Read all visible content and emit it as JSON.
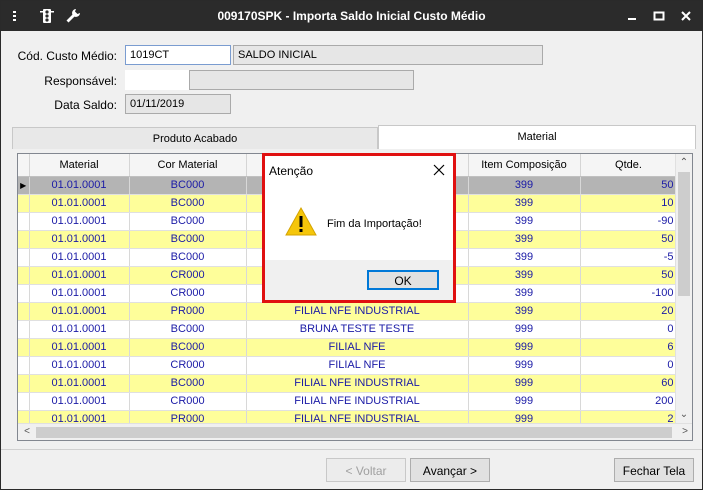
{
  "window": {
    "title": "009170SPK - Importa Saldo Inicial Custo Médio"
  },
  "form": {
    "codigo_label": "Cód. Custo Médio:",
    "codigo_value": "1019CT",
    "descricao_value": "SALDO INICIAL",
    "responsavel_label": "Responsável:",
    "responsavel_value": "",
    "data_label": "Data Saldo:",
    "data_value": "01/11/2019"
  },
  "tabs": [
    {
      "label": "Produto Acabado",
      "active": false
    },
    {
      "label": "Material",
      "active": true
    }
  ],
  "grid": {
    "columns": [
      "Material",
      "Cor Material",
      "",
      "Item Composição",
      "Qtde."
    ],
    "rows": [
      {
        "material": "01.01.0001",
        "cor": "BC000",
        "desc": "",
        "item": "399",
        "qtde": "50",
        "style": "selected"
      },
      {
        "material": "01.01.0001",
        "cor": "BC000",
        "desc": "",
        "item": "399",
        "qtde": "10",
        "style": "yellow"
      },
      {
        "material": "01.01.0001",
        "cor": "BC000",
        "desc": "",
        "item": "399",
        "qtde": "-90",
        "style": "white"
      },
      {
        "material": "01.01.0001",
        "cor": "BC000",
        "desc": "",
        "item": "399",
        "qtde": "50",
        "style": "yellow"
      },
      {
        "material": "01.01.0001",
        "cor": "BC000",
        "desc": "",
        "item": "399",
        "qtde": "-5",
        "style": "white"
      },
      {
        "material": "01.01.0001",
        "cor": "CR000",
        "desc": "",
        "item": "399",
        "qtde": "50",
        "style": "yellow"
      },
      {
        "material": "01.01.0001",
        "cor": "CR000",
        "desc": "",
        "item": "399",
        "qtde": "-100",
        "style": "white"
      },
      {
        "material": "01.01.0001",
        "cor": "PR000",
        "desc": "FILIAL NFE INDUSTRIAL",
        "item": "399",
        "qtde": "20",
        "style": "yellow"
      },
      {
        "material": "01.01.0001",
        "cor": "BC000",
        "desc": "BRUNA TESTE TESTE",
        "item": "999",
        "qtde": "0",
        "style": "white"
      },
      {
        "material": "01.01.0001",
        "cor": "BC000",
        "desc": "FILIAL NFE",
        "item": "999",
        "qtde": "6",
        "style": "yellow"
      },
      {
        "material": "01.01.0001",
        "cor": "CR000",
        "desc": "FILIAL NFE",
        "item": "999",
        "qtde": "0",
        "style": "white"
      },
      {
        "material": "01.01.0001",
        "cor": "BC000",
        "desc": "FILIAL NFE INDUSTRIAL",
        "item": "999",
        "qtde": "60",
        "style": "yellow"
      },
      {
        "material": "01.01.0001",
        "cor": "CR000",
        "desc": "FILIAL NFE INDUSTRIAL",
        "item": "999",
        "qtde": "200",
        "style": "white"
      },
      {
        "material": "01.01.0001",
        "cor": "PR000",
        "desc": "FILIAL NFE INDUSTRIAL",
        "item": "999",
        "qtde": "2",
        "style": "yellow"
      }
    ]
  },
  "buttons": {
    "voltar": "< Voltar",
    "avancar": "Avançar >",
    "fechar": "Fechar Tela"
  },
  "dialog": {
    "title": "Atenção",
    "message": "Fim da Importação!",
    "ok": "OK"
  },
  "colors": {
    "titlebar": "#2b2b2b",
    "row_yellow": "#fefe9a",
    "row_selected": "#b4b4b4",
    "cell_text": "#1a1aa6",
    "dialog_border": "#e01010"
  },
  "icons": {
    "app": "traffic-light-icon",
    "tools": "wrench-icon",
    "warning": "warning-triangle-icon"
  }
}
